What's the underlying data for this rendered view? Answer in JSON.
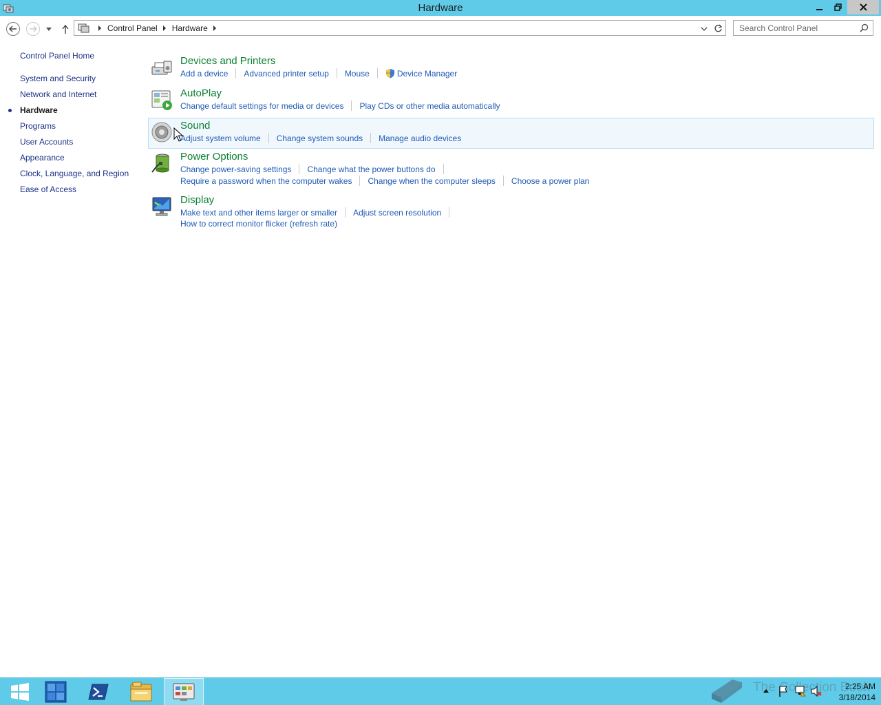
{
  "window": {
    "title": "Hardware"
  },
  "nav": {
    "crumbs": [
      "Control Panel",
      "Hardware"
    ],
    "search_placeholder": "Search Control Panel"
  },
  "sidebar": {
    "home": "Control Panel Home",
    "items": [
      {
        "label": "System and Security",
        "active": false
      },
      {
        "label": "Network and Internet",
        "active": false
      },
      {
        "label": "Hardware",
        "active": true
      },
      {
        "label": "Programs",
        "active": false
      },
      {
        "label": "User Accounts",
        "active": false
      },
      {
        "label": "Appearance",
        "active": false
      },
      {
        "label": "Clock, Language, and Region",
        "active": false
      },
      {
        "label": "Ease of Access",
        "active": false
      }
    ]
  },
  "categories": [
    {
      "title": "Devices and Printers",
      "icon": "printer-icon",
      "rows": [
        [
          "Add a device",
          "Advanced printer setup",
          "Mouse",
          "Device Manager"
        ]
      ]
    },
    {
      "title": "AutoPlay",
      "icon": "autoplay-icon",
      "rows": [
        [
          "Change default settings for media or devices",
          "Play CDs or other media automatically"
        ]
      ]
    },
    {
      "title": "Sound",
      "icon": "speaker-icon",
      "rows": [
        [
          "Adjust system volume",
          "Change system sounds",
          "Manage audio devices"
        ]
      ]
    },
    {
      "title": "Power Options",
      "icon": "battery-icon",
      "rows": [
        [
          "Change power-saving settings",
          "Change what the power buttons do"
        ],
        [
          "Require a password when the computer wakes",
          "Change when the computer sleeps",
          "Choose a power plan"
        ]
      ]
    },
    {
      "title": "Display",
      "icon": "monitor-icon",
      "rows": [
        [
          "Make text and other items larger or smaller",
          "Adjust screen resolution"
        ],
        [
          "How to correct monitor flicker (refresh rate)"
        ]
      ]
    }
  ],
  "taskbar": {
    "apps": [
      "start-button",
      "server-manager-icon",
      "powershell-icon",
      "file-explorer-icon",
      "control-panel-icon"
    ],
    "clock_time": "2:25 AM",
    "clock_date": "3/18/2014",
    "watermark": "The Collection Book"
  },
  "colors": {
    "titlebar": "#5fcbe9",
    "category_title": "#0b8132",
    "link": "#1e5ab4",
    "nav_link": "#1e3287"
  }
}
